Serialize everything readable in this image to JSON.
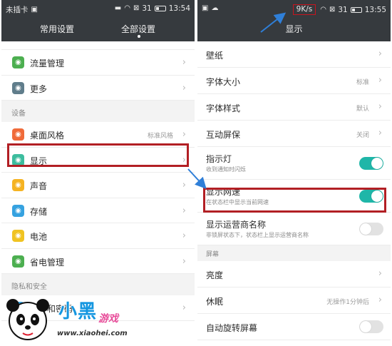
{
  "left": {
    "status": {
      "carrier": "未插卡",
      "signal": "31",
      "time": "13:54"
    },
    "tabs": [
      "常用设置",
      "全部设置"
    ],
    "rows": [
      {
        "label": "流量管理",
        "icon_color": "#4caf50",
        "icon": "traffic-icon"
      },
      {
        "label": "更多",
        "icon_color": "#607d8b",
        "icon": "more-icon"
      }
    ],
    "section_device": "设备",
    "device_rows": [
      {
        "label": "桌面风格",
        "value": "标准风格",
        "icon_color": "#f06b3a",
        "icon": "home-icon"
      },
      {
        "label": "显示",
        "value": "",
        "icon_color": "#3dbd9e",
        "icon": "display-icon"
      },
      {
        "label": "声音",
        "value": "",
        "icon_color": "#f5b322",
        "icon": "sound-icon"
      },
      {
        "label": "存储",
        "value": "",
        "icon_color": "#36a2e0",
        "icon": "storage-icon"
      },
      {
        "label": "电池",
        "value": "",
        "icon_color": "#f0c322",
        "icon": "battery-icon"
      },
      {
        "label": "省电管理",
        "value": "",
        "icon_color": "#4caf50",
        "icon": "power-save-icon"
      }
    ],
    "section_privacy": "隐私和安全",
    "privacy_rows": [
      {
        "label": "锁屏和密码",
        "icon_color": "#36a2e0",
        "icon": "lock-icon"
      }
    ]
  },
  "right": {
    "status": {
      "netspeed": "9K/s",
      "signal": "31",
      "time": "13:55"
    },
    "title": "显示",
    "rows": [
      {
        "label": "壁纸",
        "value": ""
      },
      {
        "label": "字体大小",
        "value": "标准"
      },
      {
        "label": "字体样式",
        "value": "默认"
      },
      {
        "label": "互动屏保",
        "value": "关闭"
      }
    ],
    "indicator": {
      "label": "指示灯",
      "sub": "收到通知时闪烁",
      "on": true
    },
    "netspeed_row": {
      "label": "显示网速",
      "sub": "在状态栏中显示当前网速",
      "on": true
    },
    "carrier_row": {
      "label": "显示运营商名称",
      "sub": "非锁屏状态下，状态栏上显示运营商名称",
      "on": false
    },
    "section_screen": "屏幕",
    "screen_rows": [
      {
        "label": "亮度",
        "value": ""
      },
      {
        "label": "休眠",
        "value": "无操作1分钟后"
      }
    ],
    "rotate_row": {
      "label": "自动旋转屏幕",
      "on": false
    }
  },
  "watermark": {
    "brand": "小黑",
    "sub": "游戏",
    "url": "www.xiaohei.com"
  },
  "colors": {
    "topbar": "#363a3e",
    "highlight": "#b21f24",
    "toggle_on": "#1fb6a8",
    "arrow": "#2f7fd8"
  }
}
